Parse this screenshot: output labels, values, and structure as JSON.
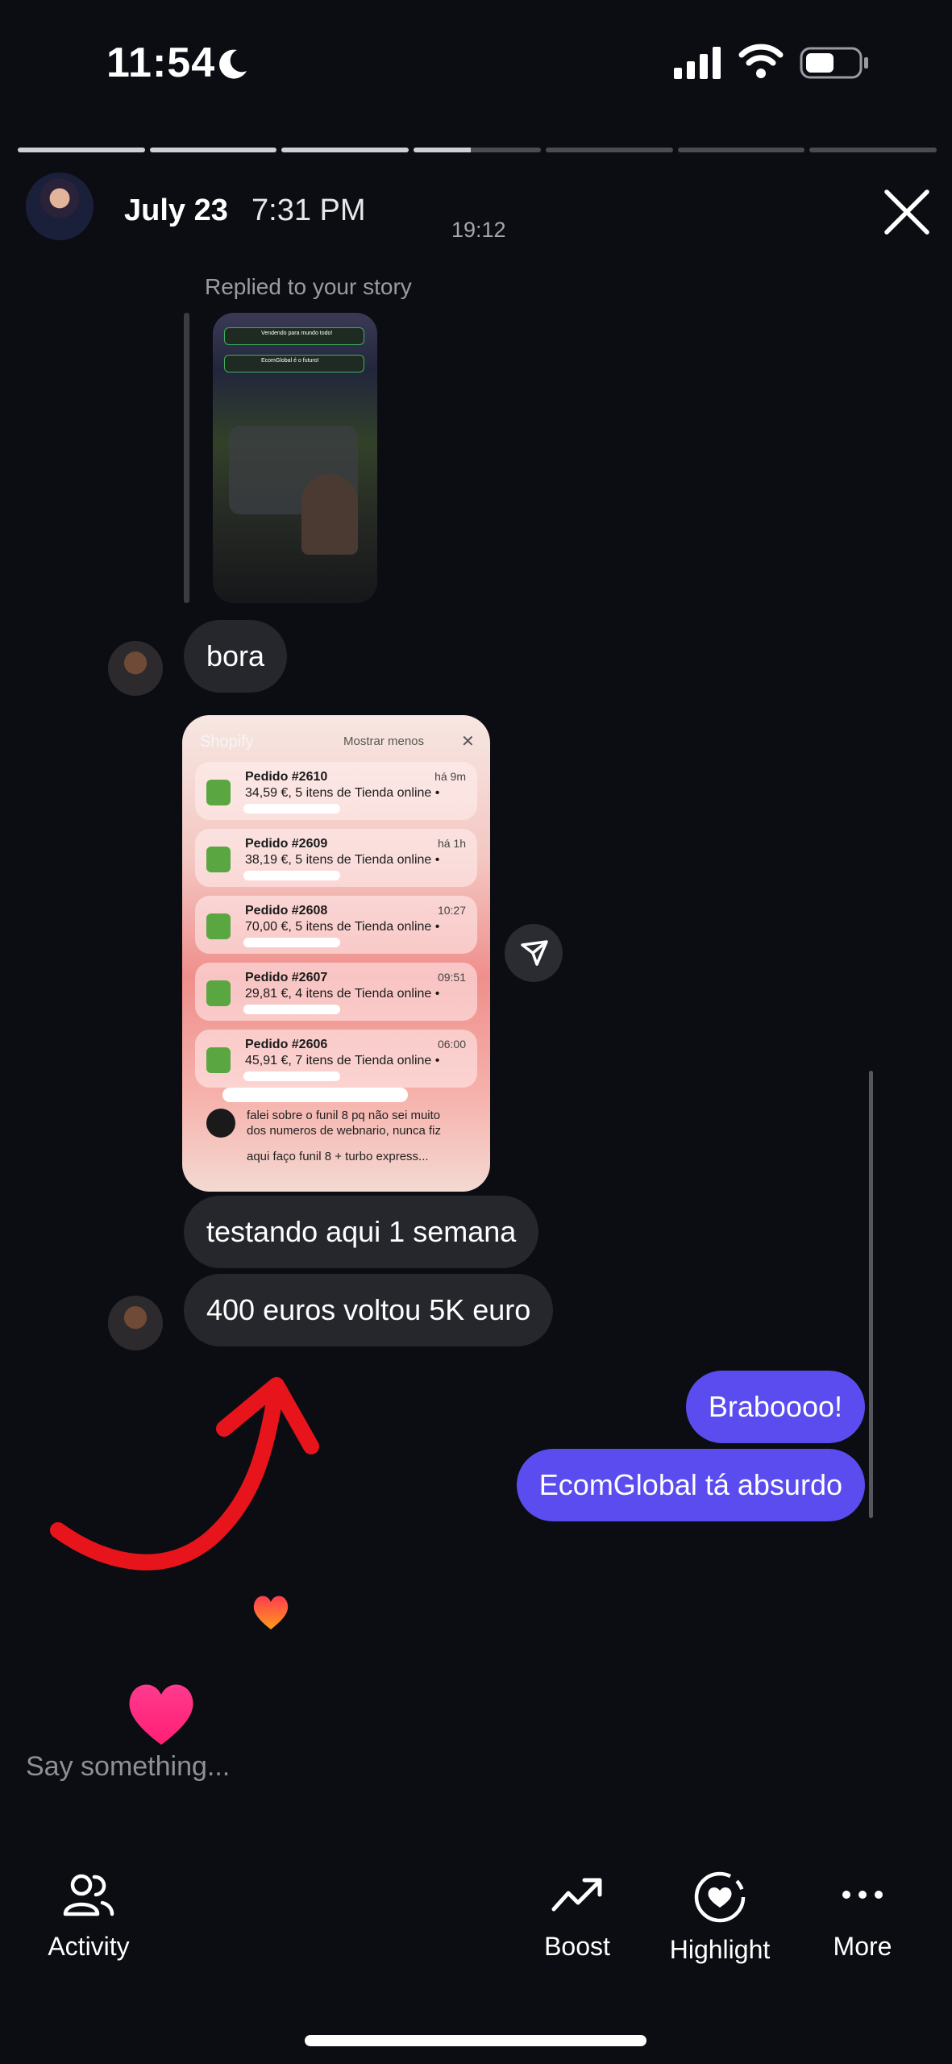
{
  "status_bar": {
    "time": "11:54",
    "battery_level": 0.55
  },
  "story_progress": {
    "segments": 7,
    "current_index": 3,
    "current_fill": 0.45
  },
  "header": {
    "date": "July 23",
    "time": "7:31 PM",
    "timestamp": "19:12"
  },
  "chat": {
    "replied_label": "Replied to your story",
    "story_thumb_lines": [
      "Vendendo para mundo todo!",
      "EcomGlobal é o futuro!"
    ],
    "messages": [
      {
        "from": "them",
        "text": "bora"
      },
      {
        "from": "them",
        "text": "testando aqui 1 semana"
      },
      {
        "from": "them",
        "text": "400 euros voltou 5K euro"
      },
      {
        "from": "me",
        "text": "Braboooo!"
      },
      {
        "from": "me",
        "text": "EcomGlobal tá absurdo"
      }
    ],
    "shared_image": {
      "app": "Shopify",
      "collapse": "Mostrar menos",
      "orders": [
        {
          "title": "Pedido #2610",
          "detail": "34,59 €, 5 itens de Tienda online •",
          "time": "há 9m"
        },
        {
          "title": "Pedido #2609",
          "detail": "38,19 €, 5 itens de Tienda online •",
          "time": "há 1h"
        },
        {
          "title": "Pedido #2608",
          "detail": "70,00 €, 5 itens de Tienda online •",
          "time": "10:27"
        },
        {
          "title": "Pedido #2607",
          "detail": "29,81 €, 4 itens de Tienda online •",
          "time": "09:51"
        },
        {
          "title": "Pedido #2606",
          "detail": "45,91 €, 7 itens de Tienda online •",
          "time": "06:00"
        }
      ],
      "message_lines": [
        "falei sobre o funil 8 pq não sei muito",
        "dos numeros de webnario, nunca fiz"
      ],
      "message_tail": "aqui faço funil 8 + turbo express..."
    }
  },
  "composer": {
    "placeholder": "Say something..."
  },
  "bottom_bar": {
    "activity": "Activity",
    "boost": "Boost",
    "highlight": "Highlight",
    "more": "More"
  },
  "colors": {
    "accent": "#5b4cf0",
    "bubble_them": "#25272d",
    "background": "#0b0d12",
    "arrow": "#e8141c"
  }
}
